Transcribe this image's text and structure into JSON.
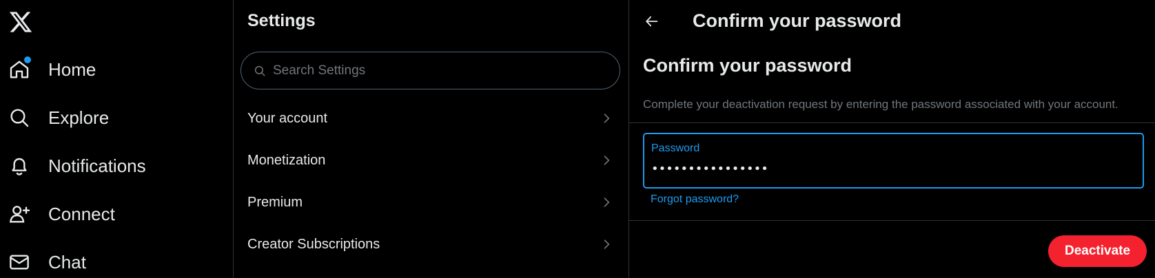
{
  "nav": {
    "logo_icon": "x-logo-icon",
    "items": [
      {
        "label": "Home",
        "icon": "home-icon",
        "has_notification_dot": true
      },
      {
        "label": "Explore",
        "icon": "search-icon"
      },
      {
        "label": "Notifications",
        "icon": "bell-icon"
      },
      {
        "label": "Connect",
        "icon": "person-add-icon"
      },
      {
        "label": "Chat",
        "icon": "mail-icon"
      }
    ]
  },
  "settings": {
    "title": "Settings",
    "search_placeholder": "Search Settings",
    "items": [
      {
        "label": "Your account"
      },
      {
        "label": "Monetization"
      },
      {
        "label": "Premium"
      },
      {
        "label": "Creator Subscriptions"
      }
    ]
  },
  "confirm": {
    "header_title": "Confirm your password",
    "section_title": "Confirm your password",
    "description": "Complete your deactivation request by entering the password associated with your account.",
    "password_label": "Password",
    "password_value": "••••••••••••••••",
    "forgot_link": "Forgot password?",
    "deactivate_label": "Deactivate"
  },
  "colors": {
    "background": "#000000",
    "text": "#e7e9ea",
    "muted": "#71767b",
    "accent": "#1d9bf0",
    "danger": "#f4212e",
    "divider": "#2f3336"
  }
}
